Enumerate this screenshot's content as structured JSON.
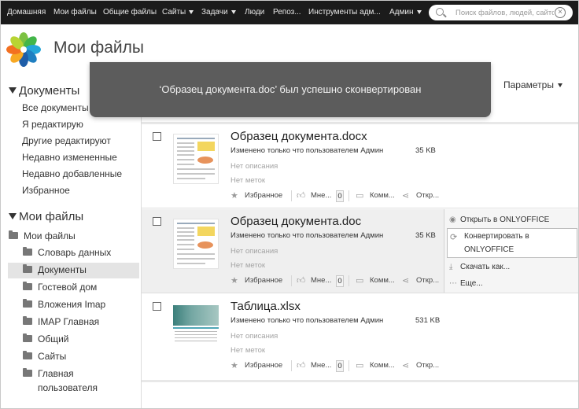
{
  "nav": {
    "items": [
      {
        "label": "Домашняя",
        "dropdown": false
      },
      {
        "label": "Мои файлы",
        "dropdown": false
      },
      {
        "label": "Общие файлы",
        "dropdown": false
      },
      {
        "label": "Сайты",
        "dropdown": true
      },
      {
        "label": "Задачи",
        "dropdown": true
      },
      {
        "label": "Люди",
        "dropdown": false
      },
      {
        "label": "Репоз...",
        "dropdown": false
      },
      {
        "label": "Инструменты адм...",
        "dropdown": false
      },
      {
        "label": "Админ",
        "dropdown": true
      }
    ],
    "search_placeholder": "Поиск файлов, людей, сайтов"
  },
  "header": {
    "title": "Мои файлы"
  },
  "sidebar": {
    "documents_heading": "Документы",
    "documents_links": [
      "Все документы",
      "Я редактирую",
      "Другие редактируют",
      "Недавно измененные",
      "Недавно добавленные",
      "Избранное"
    ],
    "myfiles_heading": "Мои файлы",
    "root_folder": "Мои файлы",
    "folders": [
      "Словарь данных",
      "Документы",
      "Гостевой дом",
      "Вложения Imap",
      "IMAP Главная",
      "Общий",
      "Сайты"
    ],
    "last_folder_line1": "Главная",
    "last_folder_line2": "пользователя",
    "selected_folder": "Документы"
  },
  "toolbar": {
    "params_label": "Параметры"
  },
  "toast": {
    "message": "‘Образец документа.doc’ был успешно сконвертирован"
  },
  "files": [
    {
      "name": "Образец документа.docx",
      "modified": "Изменено только что пользователем Админ",
      "size": "35 KB",
      "description": "Нет описания",
      "tags": "Нет меток",
      "favorite_label": "Избранное",
      "like_label": "Мне...",
      "like_count": "0",
      "comment_label": "Комм...",
      "share_label": "Откр..."
    },
    {
      "name": "Образец документа.doc",
      "modified": "Изменено только что пользователем Админ",
      "size": "35 KB",
      "description": "Нет описания",
      "tags": "Нет меток",
      "favorite_label": "Избранное",
      "like_label": "Мне...",
      "like_count": "0",
      "comment_label": "Комм...",
      "share_label": "Откр..."
    },
    {
      "name": "Таблица.xlsx",
      "modified": "Изменено только что пользователем Админ",
      "size": "531 KB",
      "description": "Нет описания",
      "tags": "Нет меток",
      "favorite_label": "Избранное",
      "like_label": "Мне...",
      "like_count": "0",
      "comment_label": "Комм...",
      "share_label": "Откр..."
    }
  ],
  "row_menu": {
    "open_label": "Открыть в ONLYOFFICE",
    "convert_line1": "Конвертировать в",
    "convert_line2": "ONLYOFFICE",
    "download_label": "Скачать как...",
    "more_label": "Еще..."
  },
  "colors": {
    "nav_bg": "#1b1b1b",
    "toast_bg": "#5c5c5c",
    "selected_bg": "#e4e4e4"
  }
}
